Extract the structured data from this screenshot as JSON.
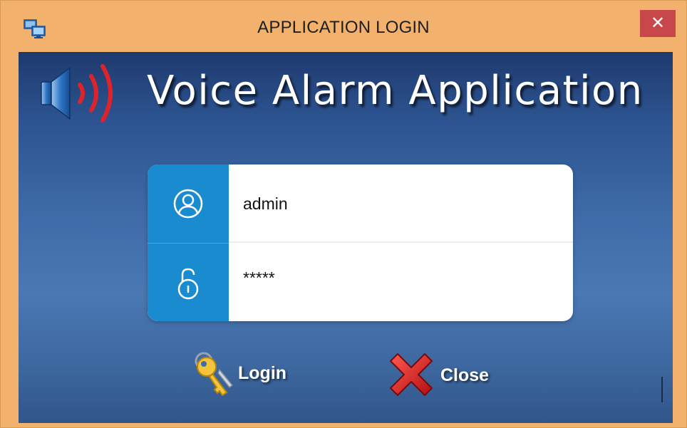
{
  "window": {
    "title": "APPLICATION LOGIN",
    "close_glyph": "✕",
    "icon": "monitors-app-icon"
  },
  "header": {
    "app_title": "Voice Alarm Application",
    "logo_icon": "speaker-sound-icon"
  },
  "login_form": {
    "username_icon": "user-icon",
    "password_icon": "padlock-icon",
    "username_value": "admin",
    "password_value": "*****"
  },
  "buttons": {
    "login_label": "Login",
    "login_icon": "keys-icon",
    "close_label": "Close",
    "close_icon": "red-x-icon"
  },
  "colors": {
    "frame": "#f2b26d",
    "close_button": "#c8474a",
    "icon_column": "#1b8bd0",
    "background_top": "#1f3a6e",
    "background_mid": "#4a78b3"
  }
}
